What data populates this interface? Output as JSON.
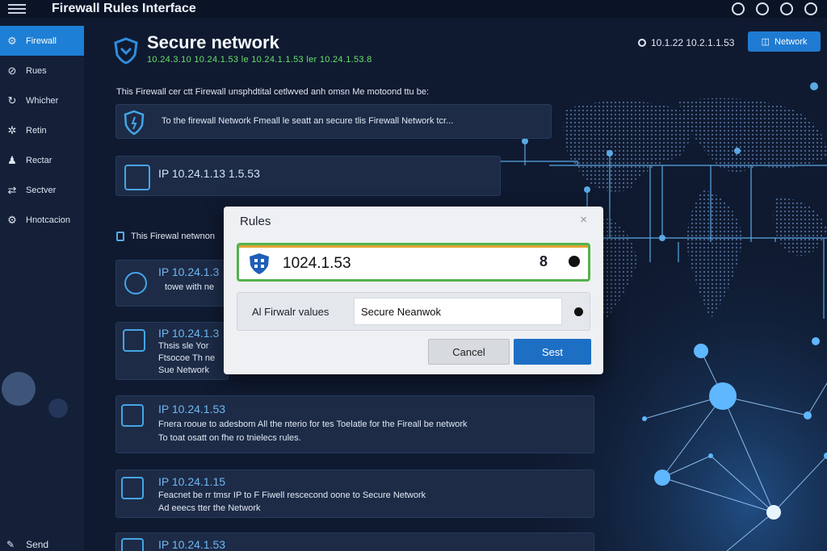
{
  "app": {
    "title": "Firewall Rules Interface"
  },
  "top_icons": [
    "map-pin-icon",
    "gear-icon",
    "compass-icon",
    "settings-icon"
  ],
  "sidebar": {
    "items": [
      {
        "label": "Firewall",
        "icon": "firewall-icon",
        "active": true
      },
      {
        "label": "Rues",
        "icon": "rules-icon"
      },
      {
        "label": "Whicher",
        "icon": "watcher-icon"
      },
      {
        "label": "Retin",
        "icon": "retin-icon"
      },
      {
        "label": "Rectar",
        "icon": "user-icon"
      },
      {
        "label": "Sectver",
        "icon": "sync-icon"
      },
      {
        "label": "Hnotcacion",
        "icon": "notification-icon"
      }
    ],
    "bottom": {
      "label": "Send",
      "icon": "pencil-icon"
    }
  },
  "header": {
    "title": "Secure network",
    "subtitle": "10.24.3.10 10.24.1.53 le 10.24.1.1.53 ler 10.24.1.53.8",
    "ip_display": "10.1.22 10.2.1.1.53",
    "network_button": "Network"
  },
  "intro": "This Firewall cer ctt Firewall unsphdtital cetlwved anh omsn Me motoond ttu be:",
  "cards": [
    {
      "text": "To the firewall Network Fmeall le seatt an secure tlis Firewall Network tcr..."
    },
    {
      "ip": "IP 10.24.1.13 1.5.53"
    }
  ],
  "section_note": "This Firewal netwnon",
  "rules": [
    {
      "ip": "IP 10.24.1.3",
      "lines": [
        "towe with ne"
      ]
    },
    {
      "ip": "IP 10.24.1.3",
      "lines": [
        "Thsis sle Yor",
        "Ftsocoe Th ne",
        "Sue Network"
      ]
    },
    {
      "ip": "IP 10.24.1.53",
      "lines": [
        "Fnera rooue to adesbom All the nterio for tes Toelatle for the Fireall be network",
        "To toat osatt on fhe ro tnielecs rules."
      ]
    },
    {
      "ip": "IP 10.24.1.15",
      "lines": [
        "Feacnet be rr tmsr IP to F Fiwell rescecond oone to Secure Network",
        "Ad eeecs tter the Network"
      ]
    },
    {
      "ip": "IP 10.24.1.53",
      "lines": []
    }
  ],
  "dialog": {
    "title": "Rules",
    "close": "×",
    "ip_value": "1024.1.53",
    "ip_suffix": "8",
    "values_label": "Al Firwalr values",
    "values_input": "Secure Neanwok",
    "cancel": "Cancel",
    "save": "Sest"
  },
  "colors": {
    "accent": "#1f7bd2",
    "sidebar_active": "#1d7fd6",
    "subtitle_green": "#67e06c",
    "ip_blue": "#6fb8f2"
  }
}
